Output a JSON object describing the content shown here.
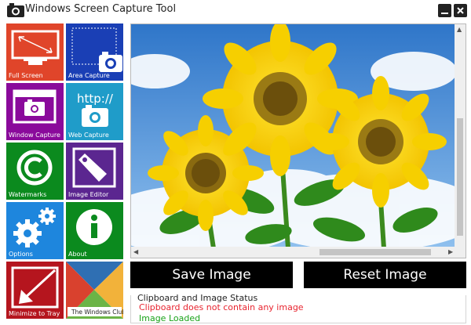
{
  "window": {
    "title": "Windows Screen Capture Tool",
    "minimize_icon": "minimize-icon",
    "close_icon": "close-icon"
  },
  "tiles": [
    {
      "id": "full-screen",
      "label": "Full Screen",
      "color": "#e0452a",
      "icon": "monitor-arrow-icon"
    },
    {
      "id": "area-capture",
      "label": "Area Capture",
      "color": "#1a3fb5",
      "icon": "camera-icon"
    },
    {
      "id": "window-capture",
      "label": "Window Capture",
      "color": "#8a0a9b",
      "icon": "window-camera-icon"
    },
    {
      "id": "web-capture",
      "label": "Web Capture",
      "color": "#1f9cc9",
      "icon": "http-camera-icon"
    },
    {
      "id": "watermarks",
      "label": "Watermarks",
      "color": "#0b8a1e",
      "icon": "copyright-icon"
    },
    {
      "id": "image-editor",
      "label": "Image Editor",
      "color": "#5b2690",
      "icon": "tag-icon"
    },
    {
      "id": "options",
      "label": "Options",
      "color": "#1e86dd",
      "icon": "gears-icon"
    },
    {
      "id": "about",
      "label": "About",
      "color": "#0b8a1e",
      "icon": "info-icon"
    },
    {
      "id": "minimize-to-tray",
      "label": "Minimize to Tray",
      "color": "#b5151e",
      "icon": "arrow-tray-icon"
    },
    {
      "id": "the-windows-club",
      "label": "The Windows Club",
      "color": "#ffffff",
      "icon": "windows-club-logo"
    }
  ],
  "buttons": {
    "save": "Save Image",
    "reset": "Reset Image"
  },
  "status": {
    "title": "Clipboard and Image Status",
    "error": "Clipboard does not contain any image",
    "ok": "Image Loaded",
    "error_color": "#e8242f",
    "ok_color": "#1aa31a"
  },
  "viewer": {
    "image": "sunflowers-photo"
  }
}
